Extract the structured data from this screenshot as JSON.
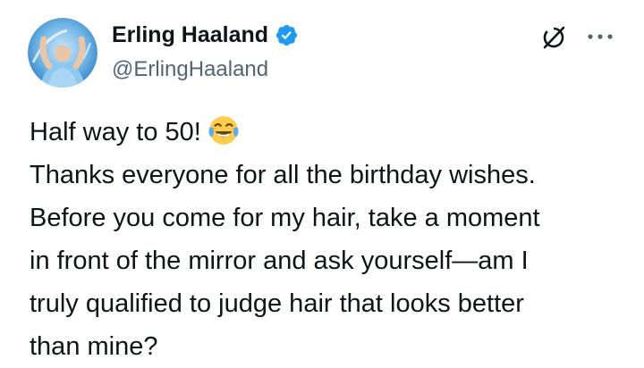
{
  "author": {
    "display_name": "Erling Haaland",
    "handle": "@ErlingHaaland",
    "verified": true,
    "verified_color": "#1d9bf0",
    "avatar_icon": "profile-photo"
  },
  "actions": {
    "grok_icon": "grok-icon",
    "more_icon": "more-options-icon"
  },
  "post": {
    "lines": [
      "Half way to 50!",
      "Thanks everyone for all the birthday wishes.",
      "Before you come for my hair, take a moment",
      "in front of the mirror and ask yourself—am I",
      "truly qualified to judge hair that looks better",
      "than mine?"
    ],
    "emoji": "face-with-tears-of-joy"
  },
  "colors": {
    "text": "#0f1419",
    "secondary": "#536471",
    "accent": "#1d9bf0"
  }
}
